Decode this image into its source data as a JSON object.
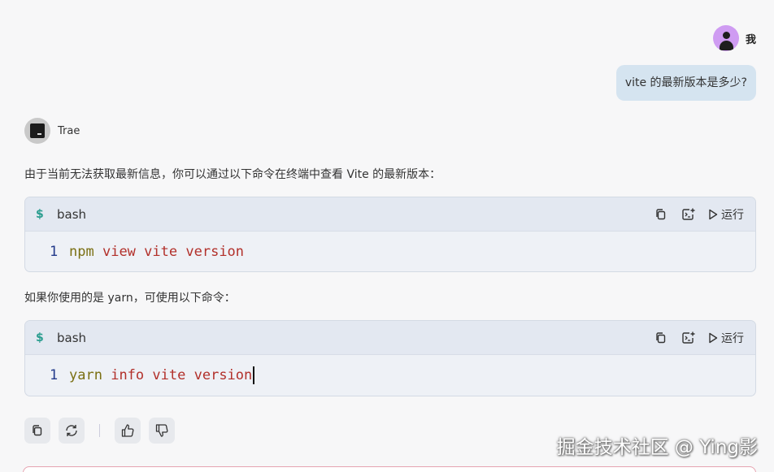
{
  "user": {
    "name": "我",
    "message": "vite 的最新版本是多少?"
  },
  "assistant": {
    "name": "Trae",
    "intro": "由于当前无法获取最新信息，你可以通过以下命令在终端中查看 Vite 的最新版本：",
    "middle": "如果你使用的是 yarn，可使用以下命令：",
    "code_blocks": [
      {
        "prompt_symbol": "$",
        "language": "bash",
        "run_label": "运行",
        "line_number": "1",
        "tokens": [
          "npm",
          "view",
          "vite",
          "version"
        ]
      },
      {
        "prompt_symbol": "$",
        "language": "bash",
        "run_label": "运行",
        "line_number": "1",
        "tokens": [
          "yarn",
          "info",
          "vite",
          "version"
        ]
      }
    ]
  },
  "actions": [
    "copy-icon",
    "refresh-icon",
    "thumbs-up-icon",
    "thumbs-down-icon"
  ],
  "watermark": "掘金技术社区 @ Ying影",
  "colors": {
    "user_bubble": "#d5e4f0",
    "code_header": "#e3e8f1",
    "keyword": "#7a6f12",
    "token": "#b2302a",
    "dollar": "#2a9d8f"
  }
}
